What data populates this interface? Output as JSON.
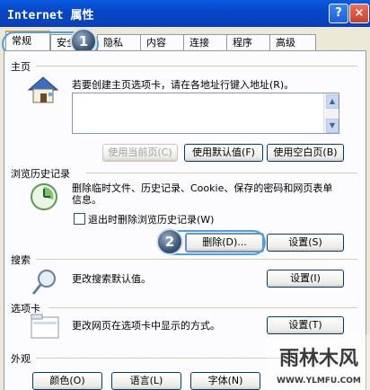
{
  "window": {
    "title": "Internet 属性",
    "help_label": "?",
    "close_label": "×"
  },
  "tabs": [
    {
      "label": "常规"
    },
    {
      "label": "安全"
    },
    {
      "label": "隐私"
    },
    {
      "label": "内容"
    },
    {
      "label": "连接"
    },
    {
      "label": "程序"
    },
    {
      "label": "高级"
    }
  ],
  "homepage": {
    "section_label": "主页",
    "description": "若要创建主页选项卡，请在各地址行键入地址(R)。",
    "use_current": "使用当前页(C)",
    "use_default": "使用默认值(F)",
    "use_blank": "使用空白页(B)"
  },
  "history": {
    "section_label": "浏览历史记录",
    "description": "删除临时文件、历史记录、Cookie、保存的密码和网页表单信息。",
    "checkbox_label": "退出时删除浏览历史记录(W)",
    "delete_button": "删除(D)...",
    "settings_button": "设置(S)"
  },
  "search": {
    "section_label": "搜索",
    "description": "更改搜索默认值。",
    "settings_button": "设置(I)"
  },
  "tabs_section": {
    "section_label": "选项卡",
    "description": "更改网页在选项卡中显示的方式。",
    "settings_button": "设置(T)"
  },
  "appearance": {
    "section_label": "外观",
    "colors_button": "颜色(O)",
    "languages_button": "语言(L)",
    "fonts_button": "字体(N)"
  },
  "markers": {
    "one": "1",
    "two": "2"
  },
  "watermark": {
    "main": "雨林木风",
    "url": "WWW.YLMFU.COM"
  }
}
